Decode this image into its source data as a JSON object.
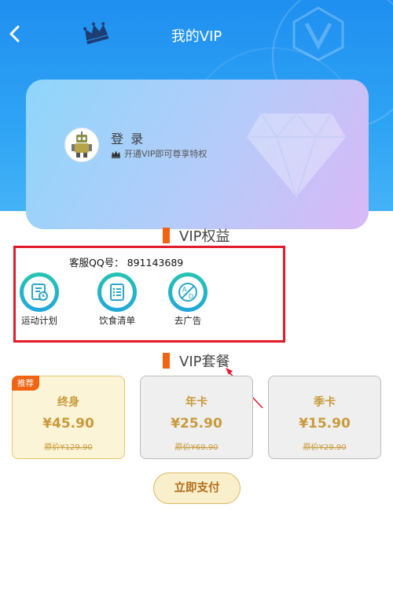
{
  "header": {
    "title": "我的VIP",
    "back_icon": "chevron-left-icon",
    "crown_icon": "crown-icon",
    "badge_icon": "vip-v-badge-icon"
  },
  "user_card": {
    "login_label": "登 录",
    "tip": "开通VIP即可尊享特权",
    "avatar_icon": "robot-avatar-icon",
    "decor_icon": "diamond-icon"
  },
  "benefits_section": {
    "title": "VIP权益",
    "qq_text": "客服QQ号： 891143689",
    "items": [
      {
        "label": "运动计划",
        "icon": "sport-plan-icon"
      },
      {
        "label": "饮食清单",
        "icon": "diet-list-icon"
      },
      {
        "label": "去广告",
        "icon": "remove-ads-icon"
      }
    ]
  },
  "packages_section": {
    "title": "VIP套餐",
    "packages": [
      {
        "badge": "推荐",
        "name": "终身",
        "price": "¥45.90",
        "original": "原价¥129.90"
      },
      {
        "name": "年卡",
        "price": "¥25.90",
        "original": "原价¥69.90"
      },
      {
        "name": "季卡",
        "price": "¥15.90",
        "original": "原价¥29.90"
      }
    ]
  },
  "pay_button": {
    "label": "立即支付"
  },
  "colors": {
    "header_blue": "#2596f2",
    "accent_orange": "#f06414",
    "gold": "#c89a3c",
    "highlight_red": "#e21b2a",
    "teal": "#26c4b0"
  }
}
